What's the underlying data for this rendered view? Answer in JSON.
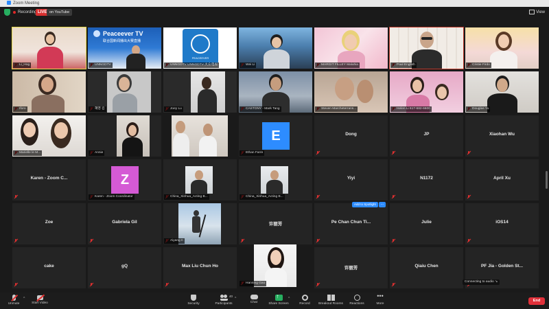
{
  "window": {
    "title": "Zoom Meeting"
  },
  "topbar": {
    "recording": "Recording",
    "live_badge": "LIVE",
    "live_target": "on YouTube",
    "view": "View"
  },
  "tiles": {
    "r1": [
      "Li_Hog",
      "UNNGDTV",
      "UNNGDTV UNNGDTV-大众电视",
      "Wei Li",
      "MARGIT FILLEY Maluhia",
      "Paul English",
      "Cristie Firdo"
    ],
    "r2": [
      "Iforo",
      "혜영 김",
      "Joey Lu",
      "CASTONY - Mark Tang",
      "Steven Marcheterrans...",
      "Helen Li 617-682-6600",
      "Douglas Yu"
    ],
    "r3": [
      "Marielle le M...",
      "Annie",
      "",
      "Ethan Farre",
      "Dong",
      "JP",
      "Xiaohan Wu"
    ],
    "r4": [
      "Karen - Zoom C...",
      "Karen - Zoom Coordinator",
      "China_Xinhua_Acting B...",
      "China_Xinhua_Acting B...",
      "Yiyi",
      "N1172",
      "April Xu"
    ],
    "r5": [
      "Zoe",
      "Gabriela Gil",
      "Aiyang II",
      "许丽芳",
      "Pe Chan Chun Ti...",
      "Julie",
      "iOS14"
    ],
    "r6": [
      "cake",
      "gQ",
      "Max Liu Chun Ho",
      "Hanning Gao",
      "许丽芳",
      "Qiaiu Chen",
      "PF Jia - Golden St..."
    ]
  },
  "avatars": {
    "ethan": "E",
    "karen": "Z"
  },
  "peaceever": {
    "line1": "Peaceever TV",
    "line2": "联合国新闻播出大赛直播",
    "logo_text": "PEACEEVER"
  },
  "hover": {
    "add_spotlight": "Add to Spotlight",
    "more": "..."
  },
  "connecting": "Connecting to audio ↘",
  "toolbar": {
    "unmute": "Unmute",
    "start_video": "Start Video",
    "security": "Security",
    "participants": "Participants",
    "participant_count": "40",
    "chat": "Chat",
    "share_screen": "Share Screen",
    "record": "Record",
    "breakout": "Breakout Rooms",
    "reactions": "Reactions",
    "more": "More",
    "end": "End"
  },
  "colors": {
    "accent_blue": "#2d8cff",
    "live_red": "#d83030",
    "end_red": "#e0313a",
    "share_green": "#27ae60",
    "ethan_avatar": "#2d8cff",
    "karen_avatar": "#d55ad5"
  }
}
